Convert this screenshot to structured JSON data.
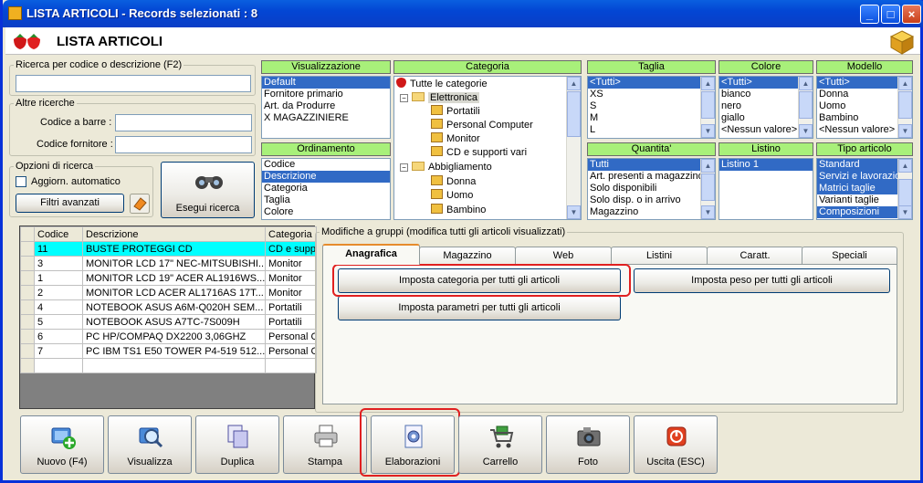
{
  "window": {
    "title": "LISTA ARTICOLI - Records selezionati : 8",
    "header_title": "LISTA ARTICOLI"
  },
  "search": {
    "code_desc_label": "Ricerca per codice o descrizione (F2)",
    "other_label": "Altre ricerche",
    "barcode_label": "Codice a barre :",
    "supplier_label": "Codice fornitore :",
    "options_label": "Opzioni di ricerca",
    "auto_update_label": "Aggiorn. automatico",
    "advanced_filters_label": "Filtri avanzati",
    "run_search_label": "Esegui ricerca"
  },
  "visualizzazione": {
    "header": "Visualizzazione",
    "items": [
      "Default",
      "Fornitore primario",
      "Art. da Produrre",
      "X MAGAZZINIERE"
    ],
    "selected": 0
  },
  "ordinamento": {
    "header": "Ordinamento",
    "items": [
      "Codice",
      "Descrizione",
      "Categoria",
      "Taglia",
      "Colore"
    ],
    "selected": 1
  },
  "categoria": {
    "header": "Categoria",
    "tree": [
      {
        "label": "Tutte le categorie",
        "level": 0,
        "kind": "root"
      },
      {
        "label": "Elettronica",
        "level": 1,
        "kind": "folder",
        "selected": true
      },
      {
        "label": "Portatili",
        "level": 2,
        "kind": "node"
      },
      {
        "label": "Personal Computer",
        "level": 2,
        "kind": "node"
      },
      {
        "label": "Monitor",
        "level": 2,
        "kind": "node"
      },
      {
        "label": "CD e supporti vari",
        "level": 2,
        "kind": "node"
      },
      {
        "label": "Abbigliamento",
        "level": 1,
        "kind": "folder"
      },
      {
        "label": "Donna",
        "level": 2,
        "kind": "node"
      },
      {
        "label": "Uomo",
        "level": 2,
        "kind": "node"
      },
      {
        "label": "Bambino",
        "level": 2,
        "kind": "node"
      }
    ]
  },
  "taglia": {
    "header": "Taglia",
    "items": [
      "<Tutti>",
      "XS",
      "S",
      "M",
      "L"
    ],
    "selected": 0
  },
  "quantita": {
    "header": "Quantita'",
    "items": [
      "Tutti",
      "Art. presenti a magazzino",
      "Solo disponibili",
      "Solo disp. o in arrivo",
      "Magazzino"
    ],
    "selected": 0
  },
  "colore": {
    "header": "Colore",
    "items": [
      "<Tutti>",
      "bianco",
      "nero",
      "giallo",
      "<Nessun valore>"
    ],
    "selected": 0
  },
  "listino": {
    "header": "Listino",
    "items": [
      "Listino 1"
    ],
    "selected": 0
  },
  "modello": {
    "header": "Modello",
    "items": [
      "<Tutti>",
      "Donna",
      "Uomo",
      "Bambino",
      "<Nessun valore>"
    ],
    "selected": 0
  },
  "tipo_articolo": {
    "header": "Tipo articolo",
    "items": [
      "Standard",
      "Servizi e lavorazioni",
      "Matrici taglie",
      "Varianti taglie",
      "Composizioni"
    ],
    "selected": [
      0,
      1,
      2,
      4
    ]
  },
  "grid": {
    "columns": [
      "",
      "Codice",
      "Descrizione",
      "Categoria"
    ],
    "rows": [
      {
        "codice": "11",
        "descrizione": "BUSTE PROTEGGI CD",
        "categoria": "CD e supporti vari"
      },
      {
        "codice": "3",
        "descrizione": "MONITOR LCD 17\" NEC-MITSUBISHI...",
        "categoria": "Monitor"
      },
      {
        "codice": "1",
        "descrizione": "MONITOR LCD 19\" ACER AL1916WS...",
        "categoria": "Monitor"
      },
      {
        "codice": "2",
        "descrizione": "MONITOR LCD ACER AL1716AS 17T...",
        "categoria": "Monitor"
      },
      {
        "codice": "4",
        "descrizione": "NOTEBOOK ASUS A6M-Q020H SEM...",
        "categoria": "Portatili"
      },
      {
        "codice": "5",
        "descrizione": "NOTEBOOK ASUS A7TC-7S009H",
        "categoria": "Portatili"
      },
      {
        "codice": "6",
        "descrizione": "PC HP/COMPAQ DX2200 3,06GHZ",
        "categoria": "Personal Computer"
      },
      {
        "codice": "7",
        "descrizione": "PC IBM TS1 E50 TOWER P4-519 512...",
        "categoria": "Personal Computer"
      }
    ],
    "current_row": 0
  },
  "modifiche": {
    "group_label": "Modifiche a gruppi (modifica tutti gli articoli visualizzati)",
    "tabs": [
      "Anagrafica",
      "Magazzino",
      "Web",
      "Listini",
      "Caratt.",
      "Speciali"
    ],
    "active_tab": 0,
    "btn_categoria": "Imposta categoria per tutti gli articoli",
    "btn_peso": "Imposta peso per tutti gli articoli",
    "btn_parametri": "Imposta parametri per tutti gli articoli"
  },
  "toolbar": [
    "Nuovo (F4)",
    "Visualizza",
    "Duplica",
    "Stampa",
    "Elaborazioni",
    "Carrello",
    "Foto",
    "Uscita (ESC)"
  ],
  "colors": {
    "title_blue": "#0346d4",
    "panel_header_green": "#a8f07a",
    "selection_blue": "#316ac5",
    "current_row_cyan": "#00ffff",
    "highlight_red": "#e02020"
  }
}
